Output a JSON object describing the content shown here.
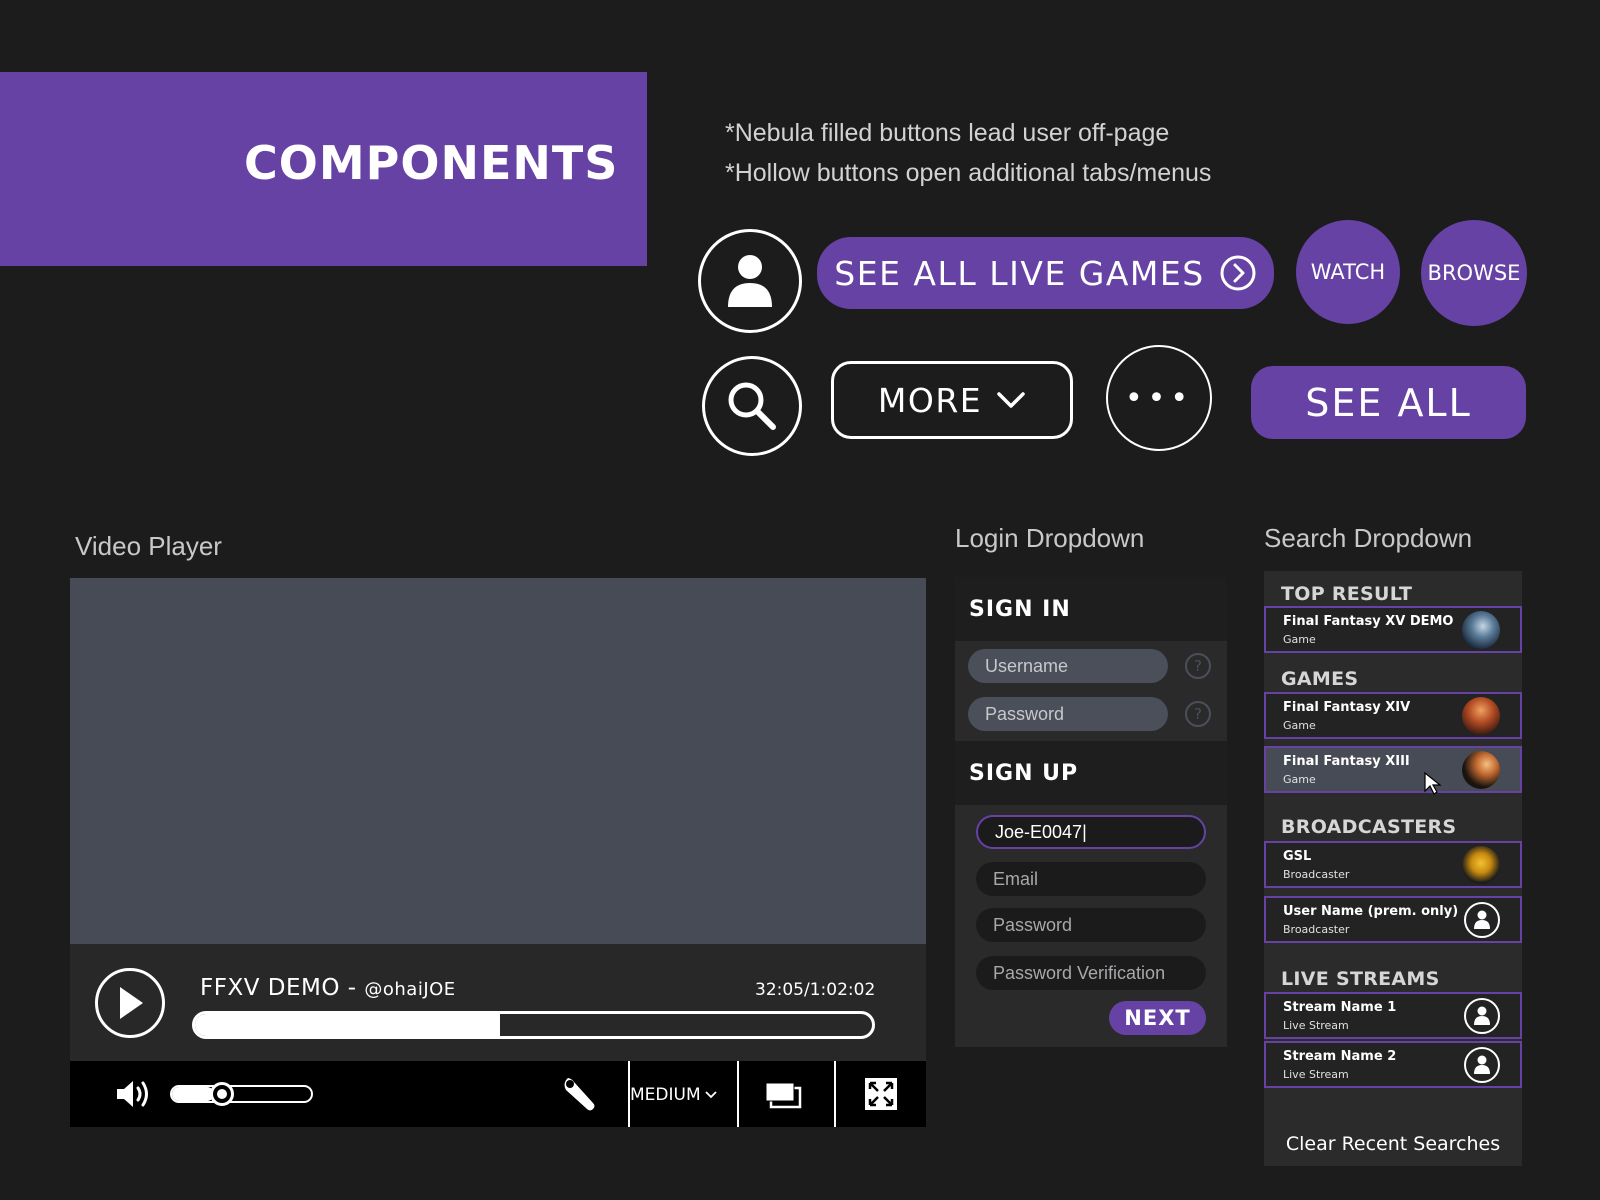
{
  "banner": {
    "title": "COMPONENTS"
  },
  "notes": [
    "*Nebula filled buttons lead user off-page",
    "*Hollow buttons open additional tabs/menus"
  ],
  "buttons": {
    "see_all_live_games": "SEE ALL LIVE GAMES",
    "watch": "WATCH",
    "browse": "BROWSE",
    "more": "MORE",
    "ellipsis": "•••",
    "see_all": "SEE ALL"
  },
  "colors": {
    "nebula": "#6642a5",
    "background": "#1c1c1d",
    "video_screen": "#474b56"
  },
  "video_player": {
    "section_label": "Video Player",
    "title": "FFXV DEMO - ",
    "user": "@ohaiJOE",
    "time": "32:05/1:02:02",
    "progress": 0.45,
    "volume": 0.3,
    "quality": "MEDIUM"
  },
  "login_dropdown": {
    "section_label": "Login Dropdown",
    "sign_in_heading": "SIGN IN",
    "sign_in_username_placeholder": "Username",
    "sign_in_password_placeholder": "Password",
    "help_glyph": "?",
    "sign_up_heading": "SIGN UP",
    "sign_up_username_value": "Joe-E0047|",
    "email_placeholder": "Email",
    "password_placeholder": "Password",
    "password_verification_placeholder": "Password Verification",
    "next_label": "NEXT"
  },
  "search_dropdown": {
    "section_label": "Search Dropdown",
    "top_result_heading": "TOP RESULT",
    "top_result": {
      "name": "Final Fantasy XV DEMO",
      "type": "Game"
    },
    "games_heading": "GAMES",
    "games": [
      {
        "name": "Final Fantasy XIV",
        "type": "Game"
      },
      {
        "name": "Final Fantasy XIII",
        "type": "Game"
      }
    ],
    "broadcasters_heading": "BROADCASTERS",
    "broadcasters": [
      {
        "name": "GSL",
        "type": "Broadcaster"
      },
      {
        "name": "User Name (prem. only)",
        "type": "Broadcaster"
      }
    ],
    "live_streams_heading": "LIVE STREAMS",
    "live_streams": [
      {
        "name": "Stream Name 1",
        "type": "Live Stream"
      },
      {
        "name": "Stream Name 2",
        "type": "Live Stream"
      }
    ],
    "clear_label": "Clear Recent Searches"
  }
}
